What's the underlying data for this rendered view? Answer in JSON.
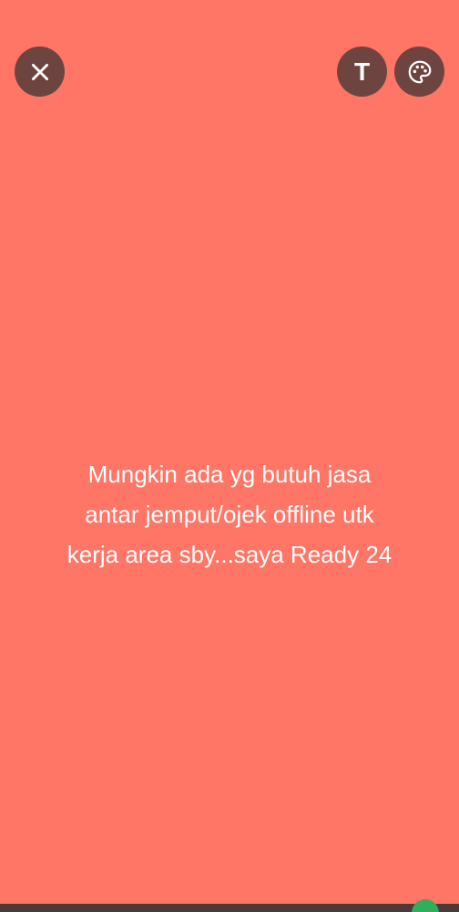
{
  "toolbar": {
    "close_icon": "close-icon",
    "text_button_label": "T",
    "text_icon": "text-format-icon",
    "palette_icon": "palette-icon"
  },
  "status": {
    "text": "Mungkin ada yg butuh jasa\nantar jemput/ojek offline utk\nkerja area sby...saya Ready 24"
  },
  "colors": {
    "background": "#ff7566",
    "button_bg": "#6e4440",
    "text": "#ffffff",
    "accent": "#2fae5c"
  }
}
